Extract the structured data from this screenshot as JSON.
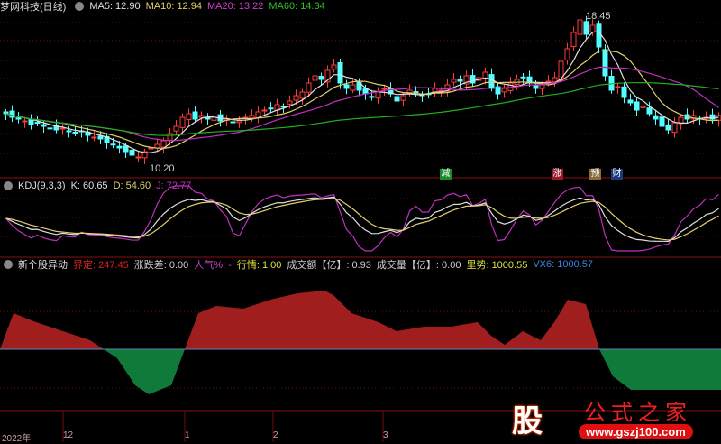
{
  "main": {
    "title": "梦网科技(日线)",
    "ma5": "MA5: 12.90",
    "ma10": "MA10: 12.94",
    "ma20": "MA20: 13.22",
    "ma60": "MA60: 14.34",
    "high_label": "18.45",
    "low_label": "10.20"
  },
  "kdj": {
    "title": "KDJ(9,3,3)",
    "k": "K: 60.65",
    "d": "D: 54.60",
    "j": "J: 72.77"
  },
  "indicator": {
    "title": "新个股异动",
    "items": [
      {
        "label": "界定: 247.45",
        "color": "#e02020"
      },
      {
        "label": "涨跌差: 0.00",
        "color": "#cccccc"
      },
      {
        "label": "人气%: -",
        "color": "#d040d0"
      },
      {
        "label": "行情: 1.00",
        "color": "#e0e040"
      },
      {
        "label": "成交额【亿】: 0.93",
        "color": "#cccccc"
      },
      {
        "label": "成交量【亿】: 0.00",
        "color": "#cccccc"
      },
      {
        "label": "里势: 1000.55",
        "color": "#e0e040"
      },
      {
        "label": "VX6: 1000.57",
        "color": "#4080e0"
      }
    ]
  },
  "badges": [
    {
      "text": "减",
      "color": "#1a8a2a"
    },
    {
      "text": "涨",
      "color": "#9a1a2a"
    },
    {
      "text": "预",
      "color": "#8a6a3a"
    },
    {
      "text": "财",
      "color": "#1a3a7a"
    }
  ],
  "axis": {
    "labels": [
      "2022年",
      "12",
      "1",
      "2",
      "3"
    ]
  },
  "logo": {
    "char": "股",
    "name": "公式之家",
    "url": "www.gszj100.com"
  },
  "colors": {
    "up": "#ff3c3c",
    "down": "#54ffff",
    "ma5": "#e0e0e0",
    "ma10": "#e0d070",
    "ma20": "#c030c0",
    "ma60": "#20b020",
    "grid": "#6a1010",
    "pos": "#a01e1e",
    "neg": "#0f7a3a"
  },
  "chart_data": {
    "type": "candlestick",
    "price_range": [
      10.2,
      18.45
    ],
    "closes": [
      12.9,
      12.7,
      12.6,
      12.5,
      12.3,
      12.4,
      12.2,
      12.1,
      12.0,
      12.1,
      11.9,
      11.8,
      11.9,
      11.7,
      11.6,
      11.5,
      11.3,
      11.2,
      11.0,
      10.8,
      10.6,
      10.5,
      10.8,
      11.0,
      11.2,
      11.4,
      11.8,
      12.2,
      12.7,
      12.9,
      12.6,
      12.8,
      12.6,
      12.7,
      12.5,
      12.6,
      12.4,
      12.5,
      12.7,
      12.8,
      13.0,
      13.1,
      13.2,
      13.4,
      13.3,
      13.6,
      13.9,
      14.1,
      14.6,
      15.0,
      14.8,
      15.3,
      15.6,
      14.6,
      14.3,
      14.5,
      14.2,
      14.0,
      13.8,
      14.1,
      14.3,
      14.0,
      13.6,
      13.9,
      14.2,
      14.1,
      13.9,
      14.0,
      14.3,
      14.2,
      14.5,
      14.8,
      14.7,
      15.0,
      14.6,
      14.9,
      15.2,
      14.3,
      14.0,
      14.3,
      14.6,
      14.8,
      14.9,
      14.6,
      14.3,
      14.5,
      14.7,
      14.9,
      15.8,
      16.5,
      17.4,
      18.1,
      17.3,
      17.8,
      16.6,
      15.0,
      14.2,
      14.4,
      13.8,
      13.5,
      13.1,
      13.3,
      12.9,
      12.6,
      12.2,
      12.0,
      12.4,
      12.7,
      12.6,
      12.8,
      12.6,
      12.7,
      12.6,
      12.8
    ],
    "indicator_values": [
      [
        0,
        0
      ],
      [
        15,
        40
      ],
      [
        40,
        30
      ],
      [
        70,
        20
      ],
      [
        100,
        10
      ],
      [
        115,
        0
      ],
      [
        130,
        -10
      ],
      [
        150,
        -40
      ],
      [
        165,
        -50
      ],
      [
        190,
        -40
      ],
      [
        205,
        0
      ],
      [
        220,
        40
      ],
      [
        240,
        48
      ],
      [
        270,
        45
      ],
      [
        300,
        55
      ],
      [
        330,
        62
      ],
      [
        360,
        65
      ],
      [
        370,
        60
      ],
      [
        390,
        40
      ],
      [
        420,
        30
      ],
      [
        440,
        20
      ],
      [
        470,
        25
      ],
      [
        500,
        25
      ],
      [
        530,
        30
      ],
      [
        545,
        15
      ],
      [
        560,
        5
      ],
      [
        580,
        20
      ],
      [
        600,
        10
      ],
      [
        615,
        30
      ],
      [
        630,
        55
      ],
      [
        650,
        50
      ],
      [
        665,
        0
      ],
      [
        680,
        -30
      ],
      [
        700,
        -45
      ],
      [
        800,
        -45
      ]
    ]
  }
}
